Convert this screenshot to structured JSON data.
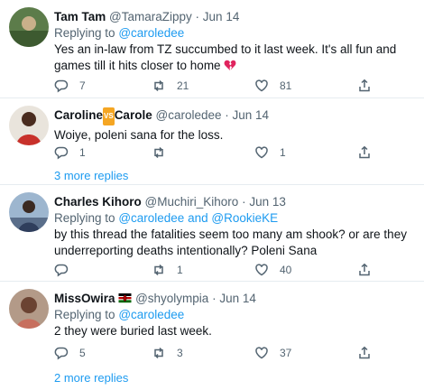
{
  "tweets": [
    {
      "name": "Tam Tam",
      "handle": "@TamaraZippy",
      "date": "Jun 14",
      "reply_prefix": "Replying to",
      "reply_to": "@caroledee",
      "text": "Yes an in-law from TZ succumbed to it last week. It's all fun and games till it hits closer to home",
      "reply_count": "7",
      "retweet_count": "21",
      "like_count": "81"
    },
    {
      "name_a": "Caroline",
      "vs_badge": "VS",
      "name_b": "Carole",
      "handle": "@caroledee",
      "date": "Jun 14",
      "text": "Woiye, poleni sana for the loss.",
      "reply_count": "1",
      "like_count": "1",
      "more_replies": "3 more replies"
    },
    {
      "name": "Charles Kihoro",
      "handle": "@Muchiri_Kihoro",
      "date": "Jun 13",
      "reply_prefix": "Replying to",
      "reply_to": "@caroledee",
      "reply_and": "and",
      "reply_to_2": "@RookieKE",
      "text": "by this thread the fatalities seem too many am shook? or are they underreporting deaths intentionally?  Poleni Sana",
      "retweet_count": "1",
      "like_count": "40"
    },
    {
      "name": "MissOwira",
      "handle": "@shyolympia",
      "date": "Jun 14",
      "reply_prefix": "Replying to",
      "reply_to": "@caroledee",
      "text": "2 they were buried last week.",
      "reply_count": "5",
      "retweet_count": "3",
      "like_count": "37",
      "more_replies": "2 more replies"
    }
  ],
  "separator": "·",
  "colors": {
    "accent": "#1d9bf0",
    "muted": "#536471",
    "heart_emoji": "#e0245e"
  }
}
